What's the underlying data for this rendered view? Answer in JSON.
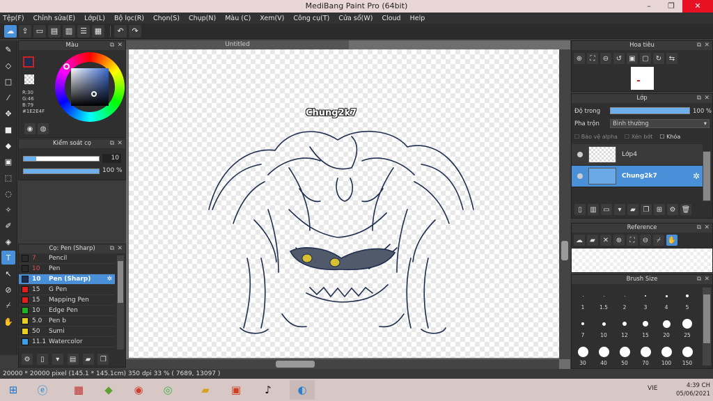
{
  "window": {
    "title": "MediBang Paint Pro (64bit)",
    "minimize": "–",
    "maximize": "❐",
    "close": "✕"
  },
  "menu": [
    "Tệp(F)",
    "Chỉnh sửa(E)",
    "Lớp(L)",
    "Bộ lọc(R)",
    "Chọn(S)",
    "Chụp(N)",
    "Màu (C)",
    "Xem(V)",
    "Công cụ(T)",
    "Cửa sổ(W)",
    "Cloud",
    "Help"
  ],
  "document": {
    "tab_title": "Untitled",
    "watermark_text": "Chung2k7"
  },
  "color_panel": {
    "title": "Màu",
    "r": "R:30",
    "g": "G:46",
    "b": "B:79",
    "hex": "#1E2E4F",
    "primary_color": "#1e2e4f",
    "secondary_color": "#ffffff"
  },
  "brush_control": {
    "title": "Kiểm soát cọ",
    "size_value": "10",
    "opacity_value": "100 %"
  },
  "brush_list": {
    "title": "Cọ: Pen (Sharp)",
    "items": [
      {
        "size": "7",
        "name": "Pencil",
        "color": "#2a2a2a",
        "size_color": "#e05050"
      },
      {
        "size": "10",
        "name": "Pen",
        "color": "#2a2a2a",
        "size_color": "#e05050"
      },
      {
        "size": "10",
        "name": "Pen (Sharp)",
        "color": "#1e2e4f",
        "size_color": "#ffffff"
      },
      {
        "size": "15",
        "name": "G Pen",
        "color": "#e02020",
        "size_color": "#dddddd"
      },
      {
        "size": "15",
        "name": "Mapping Pen",
        "color": "#e02020",
        "size_color": "#dddddd"
      },
      {
        "size": "10",
        "name": "Edge Pen",
        "color": "#20b020",
        "size_color": "#dddddd"
      },
      {
        "size": "5.0",
        "name": "Pen b",
        "color": "#e8d020",
        "size_color": "#dddddd"
      },
      {
        "size": "50",
        "name": "Sumi",
        "color": "#e8d020",
        "size_color": "#dddddd"
      },
      {
        "size": "11.1",
        "name": "Watercolor",
        "color": "#3aa0e8",
        "size_color": "#dddddd"
      }
    ]
  },
  "navigator": {
    "title": "Hoa tiêu"
  },
  "layers": {
    "title": "Lớp",
    "opacity_label": "Độ trong",
    "opacity_value": "100 %",
    "blend_label": "Pha trộn",
    "blend_value": "Bình thường",
    "protect_alpha": "Bảo vệ alpha",
    "clipping": "Xén bớt",
    "lock": "Khóa",
    "items": [
      {
        "name": "Lớp4",
        "selected": false
      },
      {
        "name": "Chung2k7",
        "selected": true
      }
    ]
  },
  "reference": {
    "title": "Reference"
  },
  "brush_size": {
    "title": "Brush Size",
    "labels": [
      "1",
      "1.5",
      "2",
      "3",
      "4",
      "5",
      "7",
      "10",
      "12",
      "15",
      "20",
      "25",
      "30",
      "40",
      "50",
      "70",
      "100",
      "150"
    ]
  },
  "status": {
    "text": "20000 * 20000 pixel  (145.1 * 145.1cm)  350 dpi  33 %  ( 7689, 13097 )"
  },
  "taskbar": {
    "lang": "VIE",
    "time": "4:39 CH",
    "date": "05/06/2021"
  }
}
